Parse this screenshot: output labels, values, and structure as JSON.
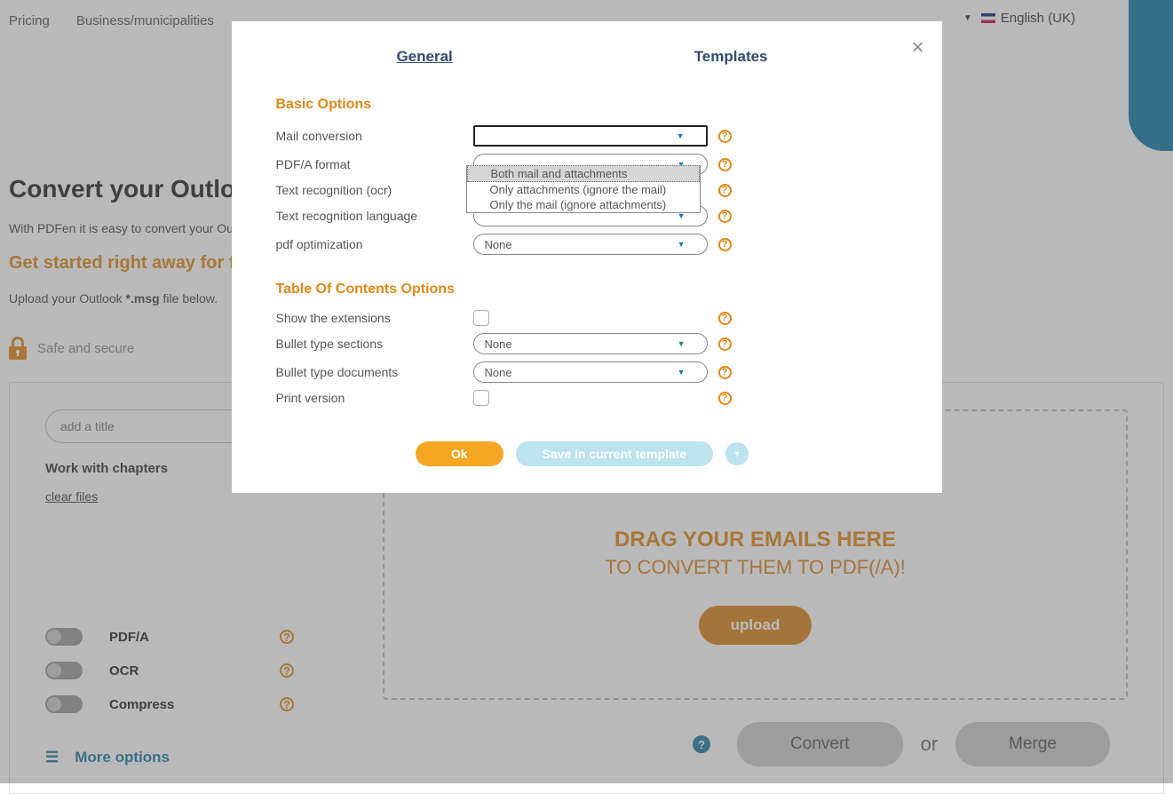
{
  "nav": {
    "pricing": "Pricing",
    "business": "Business/municipalities"
  },
  "language": {
    "label": "English (UK)"
  },
  "page": {
    "title": "Convert your Outlook ma",
    "subtitle": "With PDFen it is easy to convert your Outlook",
    "cta": "Get started right away for free!",
    "upload_instruction_pre": "Upload your Outlook ",
    "upload_instruction_bold": "*.msg",
    "upload_instruction_post": " file below.",
    "safe_secure": "Safe and secure"
  },
  "panel": {
    "title_placeholder": "add a title",
    "chapters": "Work with chapters",
    "clear_files": "clear files",
    "toggles": {
      "pdfa": "PDF/A",
      "ocr": "OCR",
      "compress": "Compress"
    },
    "more_options": "More options"
  },
  "dropzone": {
    "title": "DRAG YOUR EMAILS HERE",
    "subtitle": "TO CONVERT THEM TO PDF(/A)!",
    "upload": "upload"
  },
  "actions": {
    "convert": "Convert",
    "or": "or",
    "merge": "Merge"
  },
  "modal": {
    "tabs": {
      "general": "General",
      "templates": "Templates"
    },
    "basic_header": "Basic Options",
    "toc_header": "Table Of Contents Options",
    "options": {
      "mail_conversion": "Mail conversion",
      "pdfa_format": "PDF/A format",
      "text_recognition": "Text recognition (ocr)",
      "text_recognition_lang": "Text recognition language",
      "pdf_optimization": "pdf optimization",
      "show_extensions": "Show the extensions",
      "bullet_sections": "Bullet type sections",
      "bullet_documents": "Bullet type documents",
      "print_version": "Print version"
    },
    "values": {
      "none": "None"
    },
    "dropdown_items": {
      "both": "Both mail and attachments",
      "only_attachments": "Only attachments (ignore the mail)",
      "only_mail": "Only the mail (ignore attachments)"
    },
    "buttons": {
      "ok": "Ok",
      "save": "Save in current template"
    }
  }
}
